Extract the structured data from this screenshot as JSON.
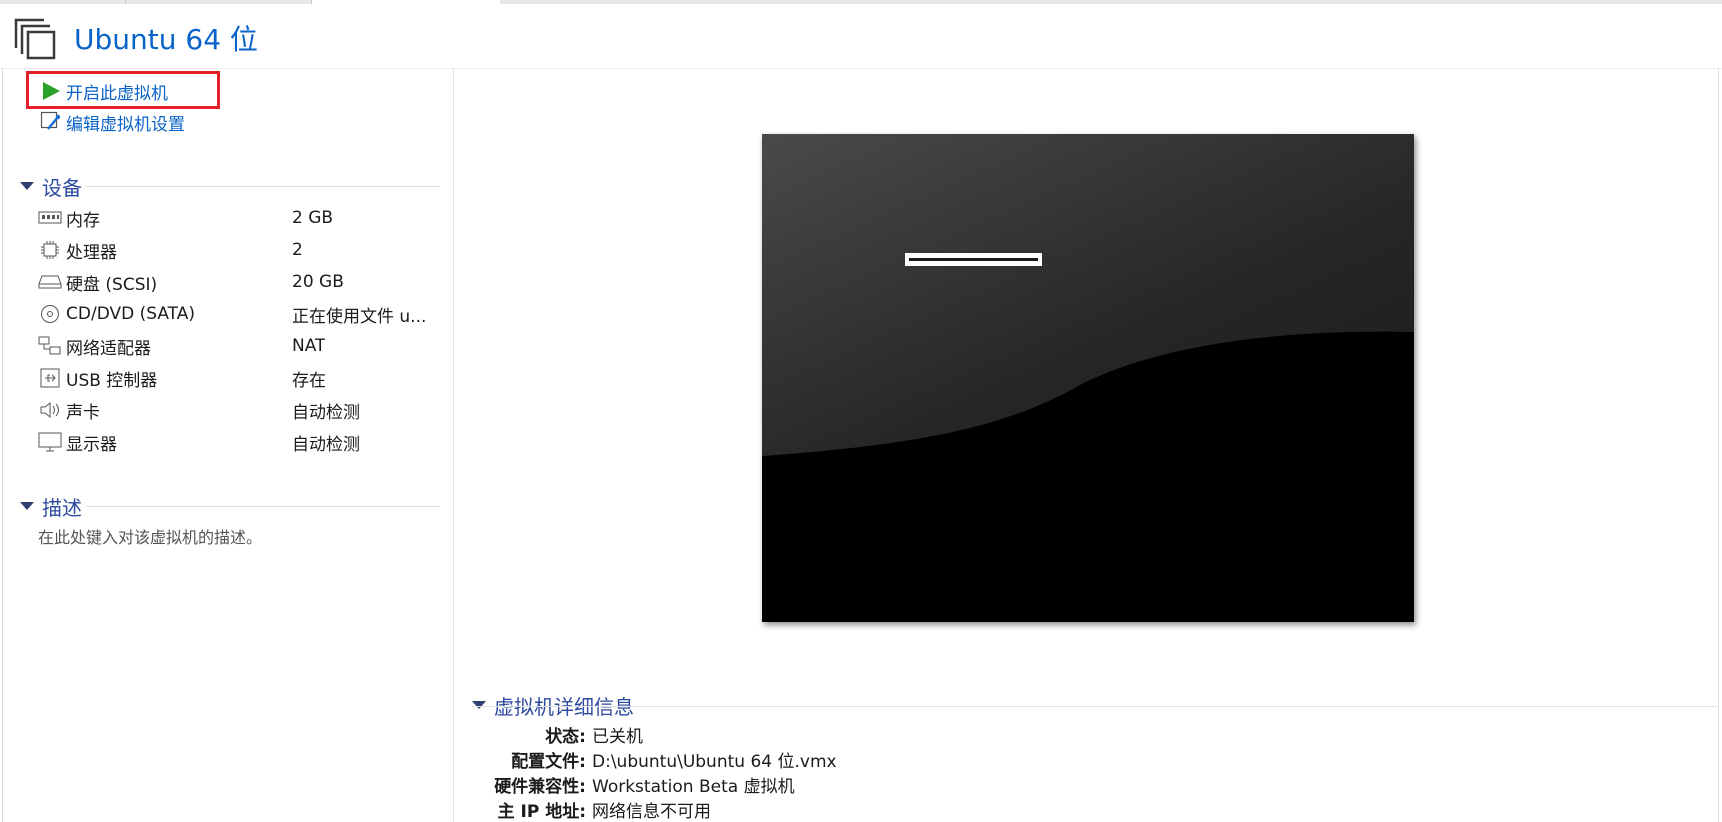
{
  "vm": {
    "title": "Ubuntu 64 位"
  },
  "actions": {
    "power_on": "开启此虚拟机",
    "edit_settings": "编辑虚拟机设置"
  },
  "devices": {
    "header": "设备",
    "items": [
      {
        "icon": "memory-icon",
        "name": "内存",
        "value": "2 GB"
      },
      {
        "icon": "processor-icon",
        "name": "处理器",
        "value": "2"
      },
      {
        "icon": "hard-disk-icon",
        "name": "硬盘 (SCSI)",
        "value": "20 GB"
      },
      {
        "icon": "cd-dvd-icon",
        "name": "CD/DVD (SATA)",
        "value": "正在使用文件 u..."
      },
      {
        "icon": "network-adapter-icon",
        "name": "网络适配器",
        "value": "NAT"
      },
      {
        "icon": "usb-controller-icon",
        "name": "USB 控制器",
        "value": "存在"
      },
      {
        "icon": "sound-card-icon",
        "name": "声卡",
        "value": "自动检测"
      },
      {
        "icon": "display-icon",
        "name": "显示器",
        "value": "自动检测"
      }
    ]
  },
  "description": {
    "header": "描述",
    "placeholder": "在此处键入对该虚拟机的描述。"
  },
  "details": {
    "header": "虚拟机详细信息",
    "rows": [
      {
        "key": "状态:",
        "value": "已关机"
      },
      {
        "key": "配置文件:",
        "value": "D:\\ubuntu\\Ubuntu 64 位.vmx"
      },
      {
        "key": "硬件兼容性:",
        "value": "Workstation Beta 虚拟机"
      },
      {
        "key": "主 IP 地址:",
        "value": "网络信息不可用"
      }
    ]
  },
  "colors": {
    "accent": "#0a63c9",
    "section_header": "#2d4aa0",
    "highlight": "#e32028",
    "play_green": "#2aa22a"
  }
}
